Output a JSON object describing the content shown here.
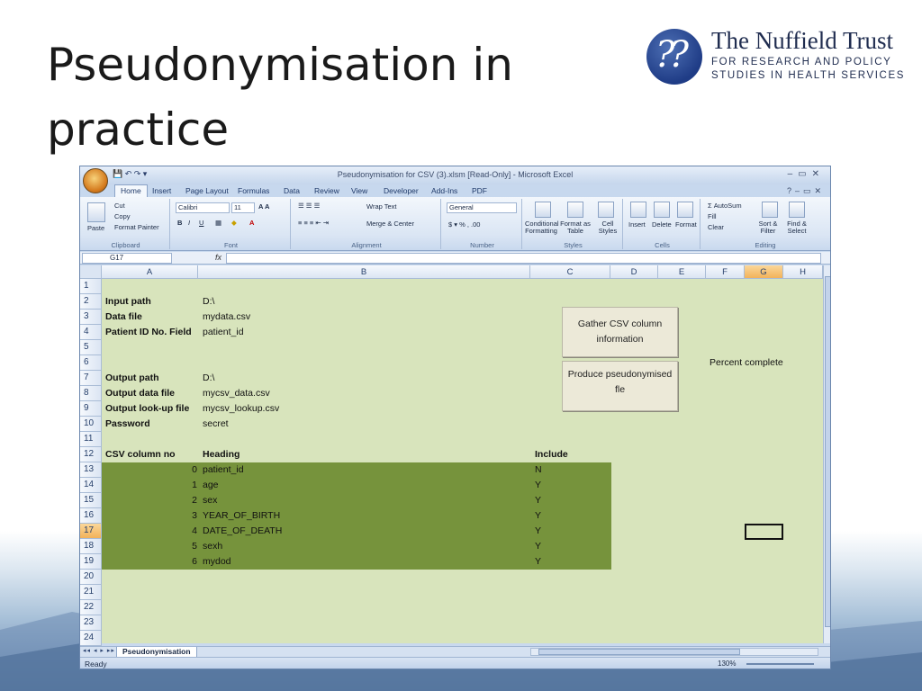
{
  "slide": {
    "title": "Pseudonymisation in practice",
    "logo": {
      "name": "The Nuffield Trust",
      "line1": "FOR RESEARCH AND POLICY",
      "line2": "STUDIES IN HEALTH SERVICES"
    }
  },
  "excel": {
    "window_title": "Pseudonymisation for CSV (3).xlsm  [Read-Only] - Microsoft Excel",
    "tabs": [
      "Home",
      "Insert",
      "Page Layout",
      "Formulas",
      "Data",
      "Review",
      "View",
      "Developer",
      "Add-Ins",
      "PDF"
    ],
    "ribbon": {
      "clipboard": {
        "paste": "Paste",
        "cut": "Cut",
        "copy": "Copy",
        "format_painter": "Format Painter",
        "label": "Clipboard"
      },
      "font": {
        "name": "Calibri",
        "size": "11",
        "label": "Font"
      },
      "alignment": {
        "wrap": "Wrap Text",
        "merge": "Merge & Center",
        "label": "Alignment"
      },
      "number": {
        "format": "General",
        "label": "Number"
      },
      "styles": {
        "conditional": "Conditional Formatting",
        "format_table": "Format as Table",
        "cell_styles": "Cell Styles",
        "label": "Styles"
      },
      "cells": {
        "insert": "Insert",
        "delete": "Delete",
        "format": "Format",
        "label": "Cells"
      },
      "editing": {
        "autosum": "AutoSum",
        "fill": "Fill",
        "clear": "Clear",
        "sort": "Sort & Filter",
        "find": "Find & Select",
        "label": "Editing"
      }
    },
    "name_box": "G17",
    "fx": "fx",
    "columns": [
      "A",
      "B",
      "C",
      "D",
      "E",
      "F",
      "G",
      "H"
    ],
    "rows": [
      "1",
      "2",
      "3",
      "4",
      "5",
      "6",
      "7",
      "8",
      "9",
      "10",
      "11",
      "12",
      "13",
      "14",
      "15",
      "16",
      "17",
      "18",
      "19",
      "20",
      "21",
      "22",
      "23",
      "24"
    ],
    "cells": {
      "input_path_label": "Input path",
      "input_path": "D:\\",
      "data_file_label": "Data file",
      "data_file": "mydata.csv",
      "pid_label": "Patient ID No. Field",
      "pid": "patient_id",
      "output_path_label": "Output path",
      "output_path": "D:\\",
      "output_data_label": "Output data file",
      "output_data": "mycsv_data.csv",
      "output_lookup_label": "Output look-up file",
      "output_lookup": "mycsv_lookup.csv",
      "password_label": "Password",
      "password": "secret",
      "col_no_header": "CSV column no",
      "heading_header": "Heading",
      "include_header": "Include",
      "percent_complete": "Percent complete"
    },
    "csv_rows": [
      {
        "no": "0",
        "heading": "patient_id",
        "include": "N"
      },
      {
        "no": "1",
        "heading": "age",
        "include": "Y"
      },
      {
        "no": "2",
        "heading": "sex",
        "include": "Y"
      },
      {
        "no": "3",
        "heading": "YEAR_OF_BIRTH",
        "include": "Y"
      },
      {
        "no": "4",
        "heading": "DATE_OF_DEATH",
        "include": "Y"
      },
      {
        "no": "5",
        "heading": "sexh",
        "include": "Y"
      },
      {
        "no": "6",
        "heading": "mydod",
        "include": "Y"
      }
    ],
    "buttons": {
      "gather": "Gather CSV column information",
      "produce": "Produce pseudonymised fle"
    },
    "sheet_tab": "Pseudonymisation",
    "status": "Ready",
    "zoom": "130%"
  }
}
